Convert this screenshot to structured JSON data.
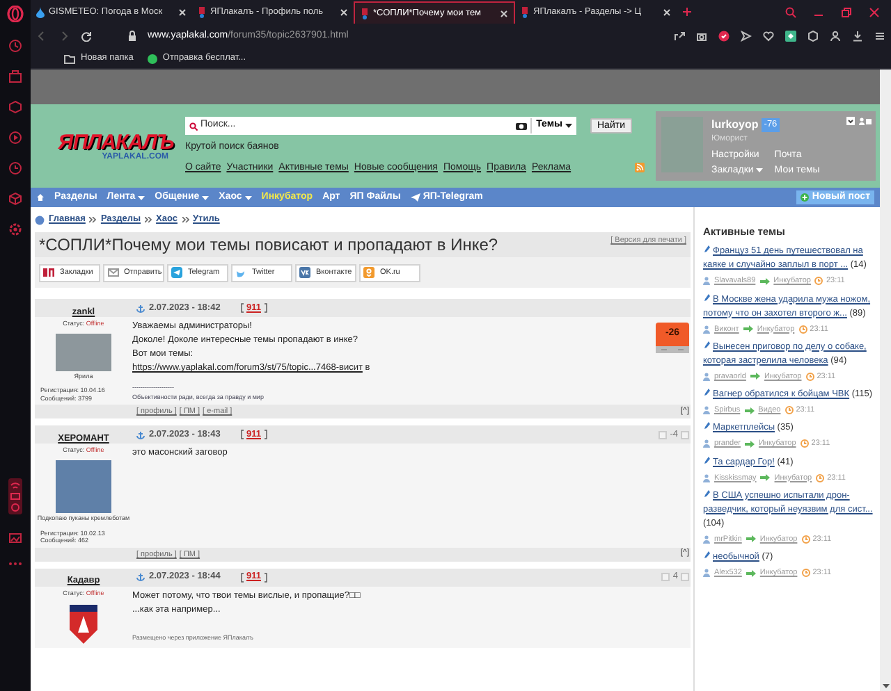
{
  "browser": {
    "tabs": [
      {
        "title": "GISMETEO: Погода в Моск",
        "selected": false,
        "kind": "drop"
      },
      {
        "title": "ЯПлакалъ - Профиль поль",
        "selected": false,
        "kind": "yp"
      },
      {
        "title": "*СОПЛИ*Почему мои тем",
        "selected": true,
        "kind": "yp"
      },
      {
        "title": "ЯПлакалъ - Разделы -> Ц",
        "selected": false,
        "kind": "yp"
      }
    ],
    "address_host": "www.yaplakal.com",
    "address_path": "/forum35/topic2637901.html",
    "bookmarks": [
      {
        "label": "Новая папка",
        "kind": "folder"
      },
      {
        "label": "Отправка бесплат...",
        "kind": "green"
      }
    ]
  },
  "header": {
    "logo_title": "ЯПЛАКАЛЪ",
    "logo_subtitle": "YAPLAKAL.COM",
    "search": {
      "placeholder": "Поиск...",
      "scope": "Темы"
    },
    "search_button": "Найти",
    "tagline": "Крутой поиск баянов",
    "links": [
      "О сайте",
      "Участники",
      "Активные темы",
      "Новые сообщения",
      "Помощь",
      "Правила",
      "Реклама"
    ]
  },
  "user": {
    "name": "lurkoyop",
    "karma": "-76",
    "rank": "Юморист",
    "links": [
      {
        "label": "Настройки",
        "dropdown": false
      },
      {
        "label": "Почта",
        "dropdown": false
      },
      {
        "label": "Закладки",
        "dropdown": true
      },
      {
        "label": "Мои темы",
        "dropdown": false
      }
    ]
  },
  "nav": {
    "items": [
      {
        "label": "Разделы",
        "dropdown": false,
        "highlight": false
      },
      {
        "label": "Лента",
        "dropdown": true,
        "highlight": false
      },
      {
        "label": "Общение",
        "dropdown": true,
        "highlight": false
      },
      {
        "label": "Хаос",
        "dropdown": true,
        "highlight": false
      },
      {
        "label": "Инкубатор",
        "dropdown": false,
        "highlight": true
      },
      {
        "label": "Арт",
        "dropdown": false,
        "highlight": false
      },
      {
        "label": "ЯП Файлы",
        "dropdown": false,
        "highlight": false
      },
      {
        "label": "ЯП-Telegram",
        "dropdown": false,
        "highlight": false
      }
    ],
    "new_post": "Новый пост"
  },
  "breadcrumb": [
    "Главная",
    "Разделы",
    "Хаос",
    "Утиль"
  ],
  "topic": {
    "title": "*СОПЛИ*Почему мои темы повисают и пропадают в Инке?",
    "print_link": "[ Версия для печати ]"
  },
  "share": [
    {
      "label": "Закладки",
      "kind": "yp"
    },
    {
      "label": "Отправить",
      "kind": "mail"
    },
    {
      "label": "Telegram",
      "kind": "telegram"
    },
    {
      "label": "Twitter",
      "kind": "twitter"
    },
    {
      "label": "Вконтакте",
      "kind": "vk"
    },
    {
      "label": "OK.ru",
      "kind": "ok"
    }
  ],
  "posts": [
    {
      "author": "zankl",
      "status_label": "Статус:",
      "status": "Offline",
      "caption": "Ярила",
      "registered": "Регистрация: 10.04.16",
      "messages": "Сообщений: 3799",
      "date": "2.07.2023 - 18:42",
      "number": "911",
      "rating": "-26",
      "kind": "big",
      "lines": [
        "Уважаемы администраторы!",
        "Доколе! Доколе интересные темы пропадают в инке?",
        "Вот мои темы:"
      ],
      "link": "https://www.yaplakal.com/forum3/st/75/topic...7468-висит",
      "link_tail": "в",
      "signature": [
        "--------------------",
        "Объективности ради, всегда за правду и мир"
      ],
      "footer": [
        "[ профиль ]",
        "[ ПМ ]",
        "[ e-mail ]"
      ],
      "top": "[^]"
    },
    {
      "author": "ХЕРОМАНТ",
      "status_label": "Статус:",
      "status": "Offline",
      "caption": "Подкопаю пуканы кремлеботам",
      "registered": "Регистрация: 10.02.13",
      "messages": "Сообщений: 462",
      "date": "2.07.2023 - 18:43",
      "number": "911",
      "rating": "-4",
      "kind": "small",
      "lines": [
        "это масонский заговор"
      ],
      "footer": [
        "[ профиль ]",
        "[ ПМ ]"
      ],
      "top": "[^]"
    },
    {
      "author": "Кадавр",
      "status_label": "Статус:",
      "status": "Offline",
      "date": "2.07.2023 - 18:44",
      "number": "911",
      "rating": "4",
      "kind": "small",
      "lines": [
        "Может потому, что твои темы вислые, и пропащие?□□",
        "...как эта например..."
      ],
      "note": "Размещено через приложение ЯПлакалъ"
    }
  ],
  "sidebar": {
    "title": "Активные темы",
    "topics": [
      {
        "title": "Француз 51 день путешествовал на каяке и случайно заплыл в порт ...",
        "count": "(14)",
        "author": "Slavavals89",
        "section": "Инкубатор",
        "time": "23:11"
      },
      {
        "title": "В Москве жена ударила мужа ножом, потому что он захотел второго ж...",
        "count": "(89)",
        "author": "Виконт",
        "section": "Инкубатор",
        "time": "23:11"
      },
      {
        "title": "Вынесен приговор по делу о собаке, которая застрелила человека",
        "count": "(94)",
        "author": "pravaorld",
        "section": "Инкубатор",
        "time": "23:11"
      },
      {
        "title": "Вагнер обратился к бойцам ЧВК",
        "count": "(115)",
        "author": "Spirbus",
        "section": "Видео",
        "time": "23:11"
      },
      {
        "title": "Маркетплейсы",
        "count": "(35)",
        "author": "prander",
        "section": "Инкубатор",
        "time": "23:11"
      },
      {
        "title": "Та сардар Гор!",
        "count": "(41)",
        "author": "Kisskissmay",
        "section": "Инкубатор",
        "time": "23:11"
      },
      {
        "title": "В США успешно испытали дрон-разведчик, который неуязвим для сист...",
        "count": "(104)",
        "author": "mrPitkin",
        "section": "Инкубатор",
        "time": "23:11"
      },
      {
        "title": "необычной",
        "count": "(7)",
        "author": "Alex532",
        "section": "Инкубатор",
        "time": "23:11"
      }
    ]
  }
}
